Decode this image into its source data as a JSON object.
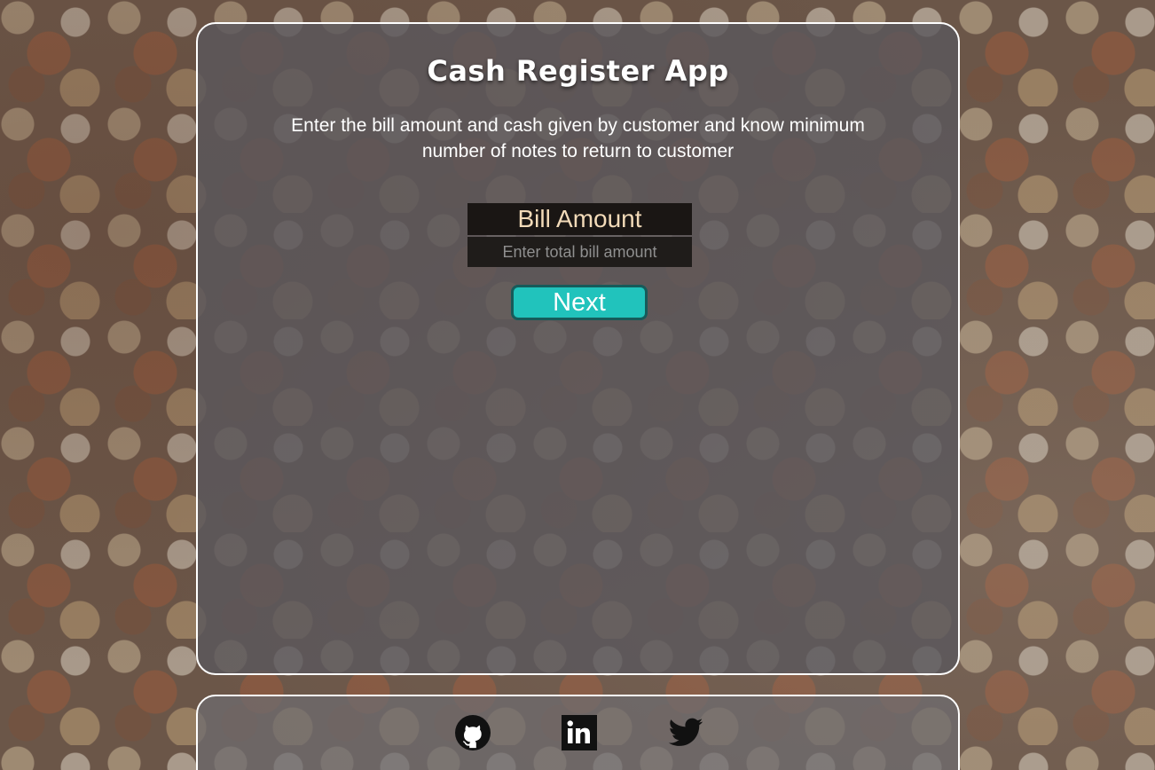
{
  "app": {
    "title": "Cash Register App",
    "description": "Enter the bill amount and cash given by customer and know minimum number of notes to return to customer"
  },
  "form": {
    "bill_label": "Bill Amount",
    "bill_placeholder": "Enter total bill amount",
    "bill_value": "",
    "next_label": "Next"
  },
  "footer": {
    "links": [
      {
        "icon": "github-icon"
      },
      {
        "icon": "linkedin-icon"
      },
      {
        "icon": "twitter-icon"
      }
    ]
  },
  "colors": {
    "accent": "#21c3bc",
    "label_text": "#f2dab8",
    "card_border": "#ffffff"
  }
}
